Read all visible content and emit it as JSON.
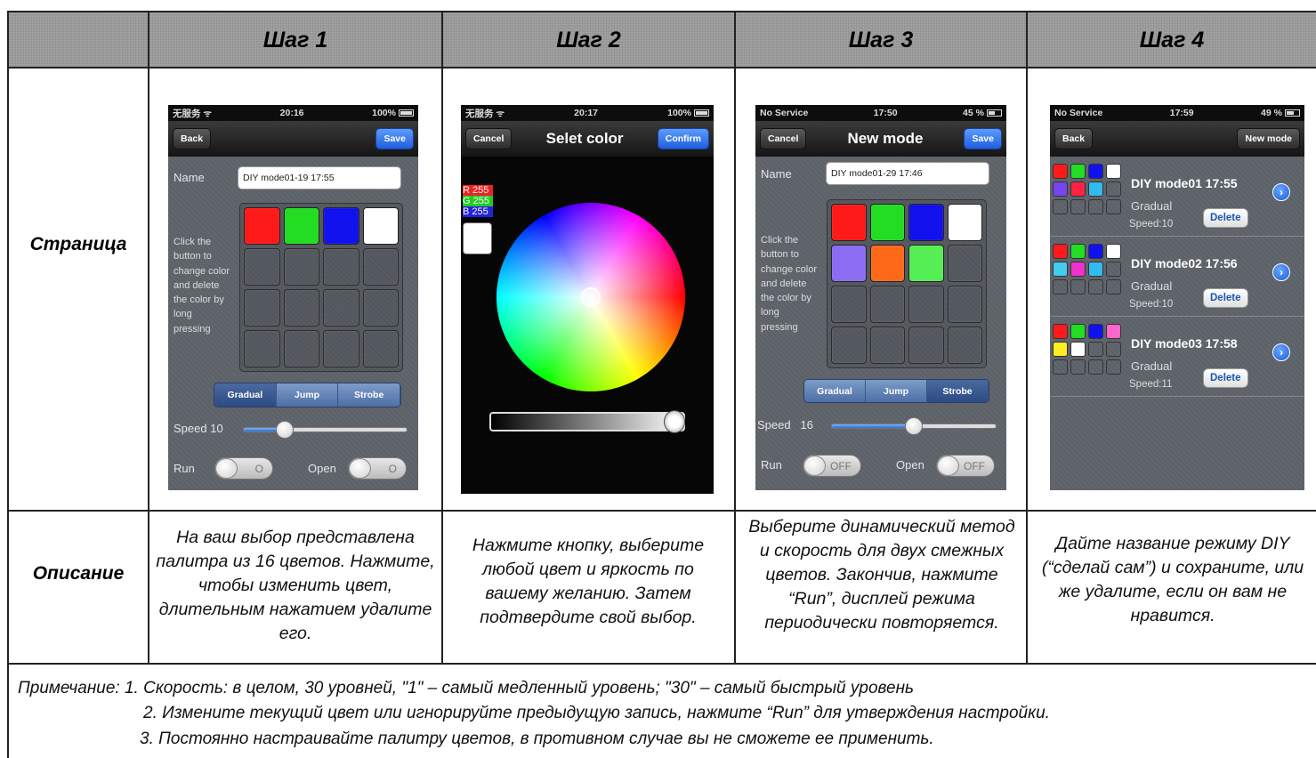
{
  "headers": {
    "step1": "Шаг 1",
    "step2": "Шаг 2",
    "step3": "Шаг 3",
    "step4": "Шаг 4"
  },
  "rows": {
    "page": "Страница",
    "description": "Описание"
  },
  "descriptions": {
    "step1": "На ваш выбор представлена палитра из 16 цветов. Нажмите, чтобы изменить цвет, длительным нажатием удалите его.",
    "step2": "Нажмите кнопку, выберите любой цвет и яркость по вашему желанию. Затем подтвердите свой выбор.",
    "step3": "Выберите динамический метод и скорость для двух смежных цветов. Закончив, нажмите “Run”, дисплей режима периодически повторяется.",
    "step4": "Дайте название режиму DIY (“сделай сам”) и сохраните, или же удалите, если он вам не нравится."
  },
  "notes": {
    "line1": "Примечание: 1. Скорость: в целом, 30 уровней, \"1\" – самый медленный уровень; \"30\" – самый быстрый уровень",
    "line2": "2. Измените текущий цвет или игнорируйте предыдущую запись, нажмите “Run” для утверждения настройки.",
    "line3": "3. Постоянно настраивайте палитру цветов, в противном случае вы не сможете ее применить."
  },
  "phone1": {
    "carrier": "无服务 ᯤ",
    "time": "20:16",
    "battery": "100%",
    "back": "Back",
    "save": "Save",
    "name_label": "Name",
    "name_value": "DIY mode01-19 17:55",
    "help": "Click the button to change color and delete the color by long pressing",
    "modes": [
      "Gradual",
      "Jump",
      "Strobe"
    ],
    "speed_label": "Speed",
    "speed_value": "10",
    "speed_fraction": 0.25,
    "run_label": "Run",
    "open_label": "Open",
    "toggle_text": "O",
    "colors": [
      "#ff1a1a",
      "#22dd22",
      "#1111ee",
      "#ffffff"
    ]
  },
  "phone2": {
    "carrier": "无服务 ᯤ",
    "time": "20:17",
    "battery": "100%",
    "cancel": "Cancel",
    "title": "Selet color",
    "confirm": "Confirm",
    "r": "R 255",
    "g": "G 255",
    "b": "B 255"
  },
  "phone3": {
    "carrier": "No Service",
    "time": "17:50",
    "battery": "45 %",
    "cancel": "Cancel",
    "title": "New mode",
    "save": "Save",
    "name_label": "Name",
    "name_value": "DIY mode01-29 17:46",
    "help": "Click the button to change color and delete the color by long pressing",
    "modes": [
      "Gradual",
      "Jump",
      "Strobe"
    ],
    "speed_label": "Speed",
    "speed_value": "16",
    "speed_fraction": 0.5,
    "run_label": "Run",
    "open_label": "Open",
    "toggle_text": "OFF",
    "colors": [
      "#ff1a1a",
      "#22dd22",
      "#1111ee",
      "#ffffff",
      "#8c6cf0",
      "#ff6a1a",
      "#55ee55"
    ]
  },
  "phone4": {
    "carrier": "No Service",
    "time": "17:59",
    "battery": "49 %",
    "back": "Back",
    "new_mode": "New mode",
    "items": [
      {
        "title": "DIY mode01 17:55",
        "method": "Gradual",
        "speed": "Speed:10",
        "delete": "Delete",
        "colors": [
          "#ff1a1a",
          "#22dd22",
          "#1111ee",
          "#ffffff",
          "#7744ee",
          "#ff2244",
          "#33bbee"
        ]
      },
      {
        "title": "DIY mode02 17:56",
        "method": "Gradual",
        "speed": "Speed:10",
        "delete": "Delete",
        "colors": [
          "#ff1a1a",
          "#22dd22",
          "#1111ee",
          "#ffffff",
          "#44ccee",
          "#ee33cc",
          "#33bbee"
        ]
      },
      {
        "title": "DIY mode03 17:58",
        "method": "Gradual",
        "speed": "Speed:11",
        "delete": "Delete",
        "colors": [
          "#ff1a1a",
          "#22dd22",
          "#1111ee",
          "#ff66cc",
          "#ffee22",
          "#ffffff"
        ]
      }
    ]
  }
}
